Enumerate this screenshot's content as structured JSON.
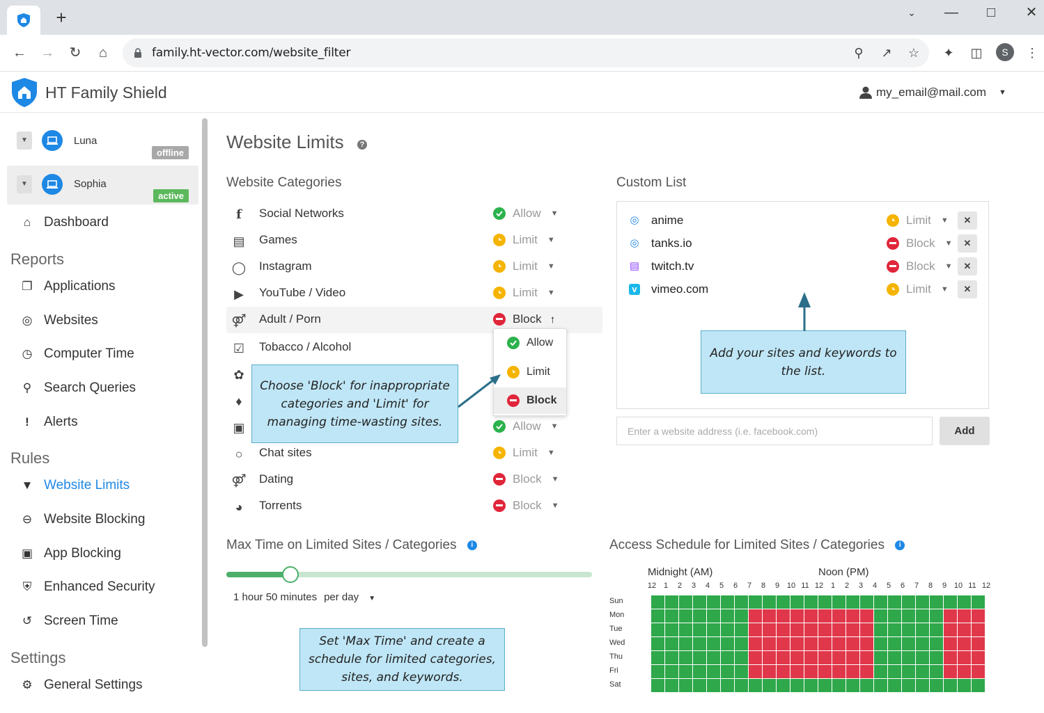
{
  "browser": {
    "url": "family.ht-vector.com/website_filter",
    "profile_initial": "S"
  },
  "app": {
    "title": "HT Family Shield",
    "user_email": "my_email@mail.com"
  },
  "sidebar": {
    "devices": [
      {
        "name": "Luna",
        "status": "offline"
      },
      {
        "name": "Sophia",
        "status": "active"
      }
    ],
    "dashboard": "Dashboard",
    "reports_heading": "Reports",
    "reports": [
      "Applications",
      "Websites",
      "Computer Time",
      "Search Queries",
      "Alerts"
    ],
    "rules_heading": "Rules",
    "rules": [
      "Website Limits",
      "Website Blocking",
      "App Blocking",
      "Enhanced Security",
      "Screen Time"
    ],
    "settings_heading": "Settings",
    "settings": [
      "General Settings"
    ]
  },
  "main": {
    "title": "Website Limits",
    "categories_heading": "Website Categories",
    "categories": [
      {
        "name": "Social Networks",
        "status": "Allow"
      },
      {
        "name": "Games",
        "status": "Limit"
      },
      {
        "name": "Instagram",
        "status": "Limit"
      },
      {
        "name": "YouTube / Video",
        "status": "Limit"
      },
      {
        "name": "Adult / Porn",
        "status": "Block"
      },
      {
        "name": "Tobacco / Alcohol",
        "status": ""
      },
      {
        "name": "",
        "status": ""
      },
      {
        "name": "",
        "status": ""
      },
      {
        "name": "",
        "status": "Allow"
      },
      {
        "name": "Chat sites",
        "status": "Limit"
      },
      {
        "name": "Dating",
        "status": "Block"
      },
      {
        "name": "Torrents",
        "status": "Block"
      }
    ],
    "dropdown_options": [
      "Allow",
      "Limit",
      "Block"
    ],
    "custom_heading": "Custom List",
    "custom_list": [
      {
        "name": "anime",
        "status": "Limit"
      },
      {
        "name": "tanks.io",
        "status": "Block"
      },
      {
        "name": "twitch.tv",
        "status": "Block"
      },
      {
        "name": "vimeo.com",
        "status": "Limit"
      }
    ],
    "website_input_placeholder": "Enter a website address (i.e. facebook.com)",
    "add_button": "Add",
    "max_time_heading": "Max Time on Limited Sites / Categories",
    "max_time_value": "1 hour 50 minutes",
    "max_time_period": "per day",
    "max_time_fraction": 0.175,
    "schedule_heading": "Access Schedule for Limited Sites / Categories",
    "schedule_midnight": "Midnight (AM)",
    "schedule_noon": "Noon (PM)",
    "schedule_hours": [
      "12",
      "1",
      "2",
      "3",
      "4",
      "5",
      "6",
      "7",
      "8",
      "9",
      "10",
      "11",
      "12",
      "1",
      "2",
      "3",
      "4",
      "5",
      "6",
      "7",
      "8",
      "9",
      "10",
      "11",
      "12"
    ],
    "schedule_days": [
      "Sun",
      "Mon",
      "Tue",
      "Wed",
      "Thu",
      "Fri",
      "Sat"
    ],
    "schedule_grid": [
      "GGGGGGGGGGGGGGGGGGGGGGGG",
      "GGGGGGGRRRRRRRRRGGGGGRRR",
      "GGGGGGGRRRRRRRRRGGGGGRRR",
      "GGGGGGGRRRRRRRRRGGGGGRRR",
      "GGGGGGGRRRRRRRRRGGGGGRRR",
      "GGGGGGGRRRRRRRRRGGGGGRRR",
      "GGGGGGGGGGGGGGGGGGGGGGGG"
    ]
  },
  "callouts": {
    "block_limit": "Choose 'Block' for inappropriate categories and 'Limit' for managing time-wasting sites.",
    "custom": "Add your sites and keywords to the list.",
    "max_time": "Set 'Max Time' and create a schedule for limited categories, sites, and keywords."
  },
  "colors": {
    "allow": "#2bb24c",
    "limit": "#f5b400",
    "block": "#e0263a",
    "accent": "#1e88e5"
  }
}
